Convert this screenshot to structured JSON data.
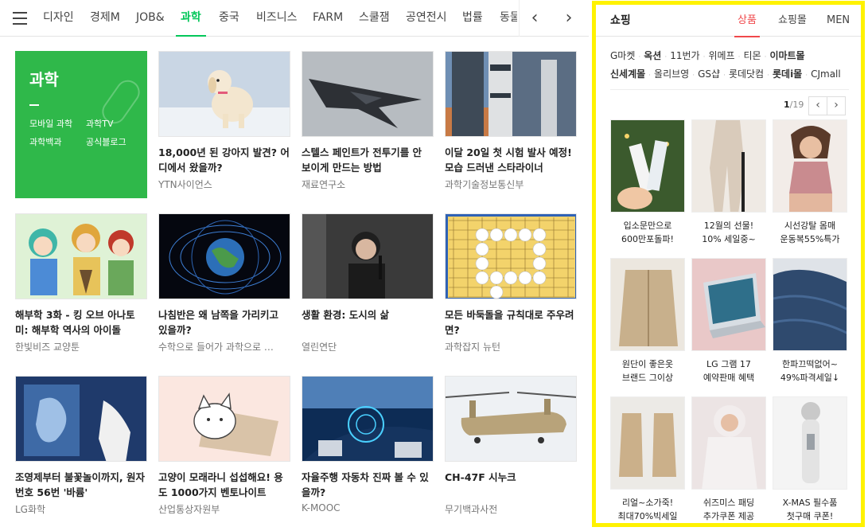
{
  "nav": {
    "tabs": [
      "디자인",
      "경제M",
      "JOB&",
      "과학",
      "중국",
      "비즈니스",
      "FARM",
      "스쿨잼",
      "공연전시",
      "법률",
      "동물"
    ],
    "active_tab": "과학",
    "prev_label": "‹",
    "next_label": "›"
  },
  "feature": {
    "title": "과학",
    "links": [
      "모바일 과학",
      "과학TV",
      "과학백과",
      "공식블로그"
    ],
    "bg_color": "#2fb84a"
  },
  "articles": [
    {
      "title": "18,000년 된 강아지 발견? 어디에서 왔을까?",
      "source": "YTN사이언스"
    },
    {
      "title": "스텔스 페인트가 전투기를 안 보이게 만드는 방법",
      "source": "재료연구소"
    },
    {
      "title": "이달 20일 첫 시험 발사 예정! 모습 드러낸 스타라이너",
      "source": "과학기술정보통신부"
    },
    {
      "title": "해부학 3화 - 킹 오브 아나토미: 해부학 역사의 아이돌",
      "source": "한빛비즈 교양툰"
    },
    {
      "title": "나침반은 왜 남쪽을 가리키고 있을까?",
      "source": "수학으로 들어가 과학으로 …"
    },
    {
      "title": "생활 환경: 도시의 삶",
      "source": "열린연단"
    },
    {
      "title": "모든 바둑돌을 규칙대로 주우려면?",
      "source": "과학잡지 뉴턴"
    },
    {
      "title": "조영제부터 불꽃놀이까지, 원자번호 56번 '바륨'",
      "source": "LG화학"
    },
    {
      "title": "고양이 모래라니 섭섭해요! 용도 1000가지 벤토나이트",
      "source": "산업통상자원부"
    },
    {
      "title": "자율주행 자동차 진짜 볼 수 있을까?",
      "source": "K-MOOC"
    },
    {
      "title": "CH-47F 시누크",
      "source": "무기백과사전"
    }
  ],
  "shopping": {
    "title": "쇼핑",
    "tabs": [
      "상품",
      "쇼핑몰",
      "MEN"
    ],
    "active_tab": "상품",
    "malls_row1": [
      "G마켓",
      "옥션",
      "11번가",
      "위메프",
      "티몬",
      "이마트몰"
    ],
    "malls_row2": [
      "신세계몰",
      "올리브영",
      "GS샵",
      "롯데닷컴",
      "롯데i몰",
      "CJmall"
    ],
    "bold_malls": [
      "옥션",
      "이마트몰",
      "신세계몰",
      "롯데i몰"
    ],
    "page_current": "1",
    "page_total": "/19",
    "products": [
      {
        "line1": "입소문만으로",
        "line2": "600만포돌파!"
      },
      {
        "line1": "12월의 선물!",
        "line2": "10% 세일중~"
      },
      {
        "line1": "시선강탈 몸매",
        "line2": "운동복55%특가"
      },
      {
        "line1": "원단이 좋은옷",
        "line2": "브랜드 그이상"
      },
      {
        "line1": "LG 그램 17",
        "line2": "예약판매 혜택"
      },
      {
        "line1": "한파끄떡없어~",
        "line2": "49%파격세일↓"
      },
      {
        "line1": "리얼~소가죽!",
        "line2": "최대70%빅세일"
      },
      {
        "line1": "쉬즈미스 패딩",
        "line2": "추가쿠폰 제공"
      },
      {
        "line1": "X-MAS 필수품",
        "line2": "첫구매 쿠폰!"
      }
    ],
    "accent_color": "#f0484b",
    "highlight_border": "#fff200"
  }
}
